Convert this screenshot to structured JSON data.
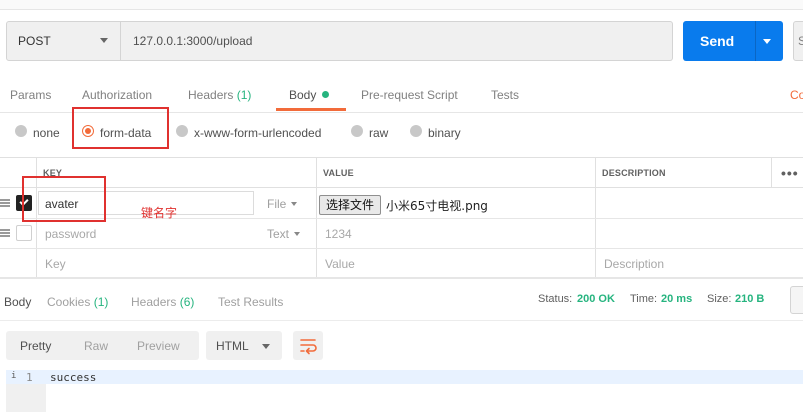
{
  "request": {
    "method": "POST",
    "url": "127.0.0.1:3000/upload",
    "send_label": "Send",
    "save_partial": "S"
  },
  "request_tabs": [
    {
      "label": "Params"
    },
    {
      "label": "Authorization"
    },
    {
      "label": "Headers",
      "count": "(1)"
    },
    {
      "label": "Body"
    },
    {
      "label": "Pre-request Script"
    },
    {
      "label": "Tests"
    }
  ],
  "cookies_partial": "Co",
  "body_types": [
    {
      "label": "none",
      "selected": false
    },
    {
      "label": "form-data",
      "selected": true
    },
    {
      "label": "x-www-form-urlencoded",
      "selected": false
    },
    {
      "label": "raw",
      "selected": false
    },
    {
      "label": "binary",
      "selected": false
    }
  ],
  "table": {
    "headers": {
      "key": "KEY",
      "value": "VALUE",
      "description": "DESCRIPTION"
    },
    "more_label": "•••",
    "rows": [
      {
        "key": "avater",
        "type": "File",
        "checked": true,
        "file_button": "选择文件",
        "file_name": "小米65寸电视.png"
      },
      {
        "key_placeholder": "password",
        "type": "Text",
        "checked": false,
        "value_placeholder": "1234"
      }
    ],
    "new_row": {
      "key_placeholder": "Key",
      "value_placeholder": "Value",
      "description_placeholder": "Description"
    }
  },
  "annotation": "键名字",
  "response": {
    "tabs": [
      {
        "label": "Body"
      },
      {
        "label": "Cookies",
        "count": "(1)"
      },
      {
        "label": "Headers",
        "count": "(6)"
      },
      {
        "label": "Test Results"
      }
    ],
    "status_label": "Status:",
    "status_value": "200 OK",
    "time_label": "Time:",
    "time_value": "20 ms",
    "size_label": "Size:",
    "size_value": "210 B",
    "views": [
      "Pretty",
      "Raw",
      "Preview"
    ],
    "format": "HTML",
    "line_number": "1",
    "line_marker": "i",
    "body": "success"
  },
  "colors": {
    "accent": "#f26b3a",
    "send": "#097bed",
    "count_green": "#26b47f",
    "annotation_red": "#e0312f"
  }
}
